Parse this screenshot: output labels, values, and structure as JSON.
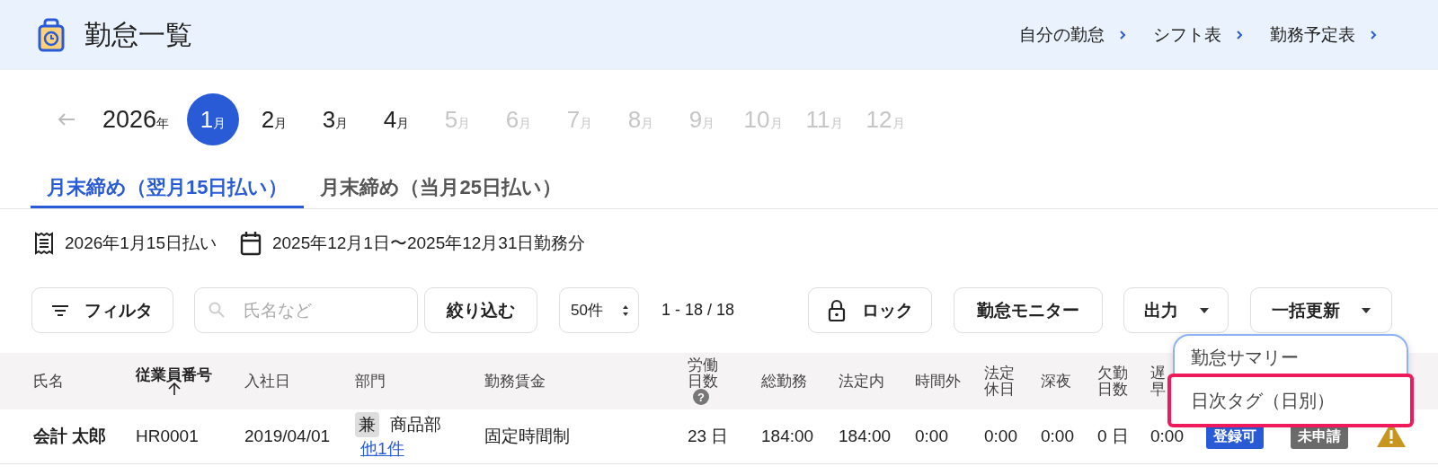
{
  "header": {
    "title": "勤怠一覧",
    "links": [
      {
        "label": "自分の勤怠"
      },
      {
        "label": "シフト表"
      },
      {
        "label": "勤務予定表"
      }
    ]
  },
  "year": {
    "value": "2026",
    "unit": "年"
  },
  "months": [
    {
      "num": "1",
      "unit": "月",
      "selected": true,
      "disabled": false
    },
    {
      "num": "2",
      "unit": "月",
      "selected": false,
      "disabled": false
    },
    {
      "num": "3",
      "unit": "月",
      "selected": false,
      "disabled": false
    },
    {
      "num": "4",
      "unit": "月",
      "selected": false,
      "disabled": false
    },
    {
      "num": "5",
      "unit": "月",
      "selected": false,
      "disabled": true
    },
    {
      "num": "6",
      "unit": "月",
      "selected": false,
      "disabled": true
    },
    {
      "num": "7",
      "unit": "月",
      "selected": false,
      "disabled": true
    },
    {
      "num": "8",
      "unit": "月",
      "selected": false,
      "disabled": true
    },
    {
      "num": "9",
      "unit": "月",
      "selected": false,
      "disabled": true
    },
    {
      "num": "10",
      "unit": "月",
      "selected": false,
      "disabled": true
    },
    {
      "num": "11",
      "unit": "月",
      "selected": false,
      "disabled": true
    },
    {
      "num": "12",
      "unit": "月",
      "selected": false,
      "disabled": true
    }
  ],
  "tabs": [
    {
      "label": "月末締め（翌月15日払い）",
      "selected": true
    },
    {
      "label": "月末締め（当月25日払い）",
      "selected": false
    }
  ],
  "info": {
    "payday": "2026年1月15日払い",
    "period": "2025年12月1日〜2025年12月31日勤務分"
  },
  "toolbar": {
    "filter": "フィルタ",
    "search_placeholder": "氏名など",
    "apply": "絞り込む",
    "per_page": "50件",
    "range": "1 - 18 / 18",
    "lock": "ロック",
    "monitor": "勤怠モニター",
    "export": "出力",
    "bulk_update": "一括更新"
  },
  "menu": [
    {
      "label": "勤怠サマリー",
      "highlighted": false
    },
    {
      "label": "日次タグ（日別）",
      "highlighted": true
    }
  ],
  "table": {
    "columns": [
      {
        "lines": [
          "氏名"
        ],
        "sorted": false
      },
      {
        "lines": [
          "従業員番号"
        ],
        "sorted": true
      },
      {
        "lines": [
          "入社日"
        ],
        "sorted": false
      },
      {
        "lines": [
          "部門"
        ],
        "sorted": false
      },
      {
        "lines": [
          "勤務賃金"
        ],
        "sorted": false
      },
      {
        "lines": [
          "労働",
          "日数"
        ],
        "sorted": false,
        "help": "?"
      },
      {
        "lines": [
          "総勤務"
        ],
        "sorted": false
      },
      {
        "lines": [
          "法定内"
        ],
        "sorted": false
      },
      {
        "lines": [
          "時間外"
        ],
        "sorted": false
      },
      {
        "lines": [
          "法定",
          "休日"
        ],
        "sorted": false
      },
      {
        "lines": [
          "深夜"
        ],
        "sorted": false
      },
      {
        "lines": [
          "欠勤",
          "日数"
        ],
        "sorted": false
      },
      {
        "lines": [
          "遅",
          "早"
        ],
        "sorted": false
      }
    ],
    "rows": [
      {
        "name": "会計 太郎",
        "employee_no": "HR0001",
        "hire_date": "2019/04/01",
        "department": {
          "tag": "兼",
          "name": "商品部",
          "more": "他1件"
        },
        "wage": "固定時間制",
        "values": [
          "23 日",
          "184:00",
          "184:00",
          "0:00",
          "0:00",
          "0:00",
          "0 日",
          "0:00"
        ],
        "statuses": [
          {
            "label": "登録可",
            "color": "#2a5bd7"
          },
          {
            "label": "未申請",
            "color": "#6b6b6b"
          }
        ],
        "warning": true
      }
    ]
  }
}
